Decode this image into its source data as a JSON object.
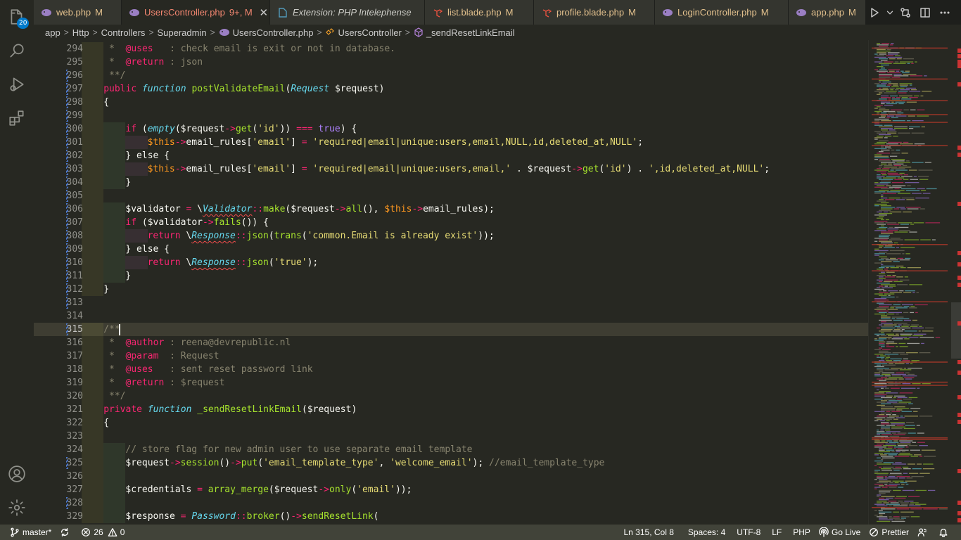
{
  "activity_bar": {
    "explorer_badge": "20",
    "items": [
      "explorer-icon",
      "search-icon",
      "run-debug-icon",
      "extensions-icon"
    ],
    "bottom": [
      "account-icon",
      "settings-gear-icon"
    ]
  },
  "tabs": [
    {
      "label": "web.php",
      "status": "M",
      "style": "mod",
      "icon": "php-elephant-icon",
      "active": false
    },
    {
      "label": "UsersController.php",
      "status": "9+, M",
      "style": "err",
      "icon": "php-elephant-icon",
      "active": true
    },
    {
      "label": "Extension: PHP Intelephense",
      "status": "",
      "style": "ital",
      "icon": "extension-file-icon",
      "active": false
    },
    {
      "label": "list.blade.php",
      "status": "M",
      "style": "mod",
      "icon": "laravel-icon",
      "active": false
    },
    {
      "label": "profile.blade.php",
      "status": "M",
      "style": "mod",
      "icon": "laravel-icon",
      "active": false
    },
    {
      "label": "LoginController.php",
      "status": "M",
      "style": "mod",
      "icon": "php-elephant-icon",
      "active": false
    },
    {
      "label": "app.php",
      "status": "M",
      "style": "mod",
      "icon": "php-elephant-icon",
      "active": false
    }
  ],
  "breadcrumb": {
    "segments": [
      "app",
      "Http",
      "Controllers",
      "Superadmin",
      "UsersController.php",
      "UsersController",
      "_sendResetLinkEmail"
    ]
  },
  "editor": {
    "current_line": 315,
    "lines": [
      {
        "n": "294",
        "mark": false
      },
      {
        "n": "295",
        "mark": false
      },
      {
        "n": "296",
        "mark": true
      },
      {
        "n": "297",
        "mark": true
      },
      {
        "n": "298",
        "mark": true
      },
      {
        "n": "299",
        "mark": true
      },
      {
        "n": "300",
        "mark": true
      },
      {
        "n": "301",
        "mark": true
      },
      {
        "n": "302",
        "mark": true
      },
      {
        "n": "303",
        "mark": true
      },
      {
        "n": "304",
        "mark": true
      },
      {
        "n": "305",
        "mark": true
      },
      {
        "n": "306",
        "mark": true
      },
      {
        "n": "307",
        "mark": true
      },
      {
        "n": "308",
        "mark": true
      },
      {
        "n": "309",
        "mark": true
      },
      {
        "n": "310",
        "mark": true
      },
      {
        "n": "311",
        "mark": true
      },
      {
        "n": "312",
        "mark": true
      },
      {
        "n": "313",
        "mark": true
      },
      {
        "n": "314",
        "mark": false
      },
      {
        "n": "315",
        "mark": true
      },
      {
        "n": "316",
        "mark": false
      },
      {
        "n": "317",
        "mark": false
      },
      {
        "n": "318",
        "mark": false
      },
      {
        "n": "319",
        "mark": false
      },
      {
        "n": "320",
        "mark": false
      },
      {
        "n": "321",
        "mark": false
      },
      {
        "n": "322",
        "mark": false
      },
      {
        "n": "323",
        "mark": false
      },
      {
        "n": "324",
        "mark": false
      },
      {
        "n": "325",
        "mark": true
      },
      {
        "n": "326",
        "mark": false
      },
      {
        "n": "327",
        "mark": false
      },
      {
        "n": "328",
        "mark": true
      },
      {
        "n": "329",
        "mark": false
      }
    ],
    "code": {
      "l294": {
        "star": " *  ",
        "tag": "@uses",
        "text": "   : check email is exit or not in database."
      },
      "l295": {
        "star": " *  ",
        "tag": "@return",
        "text": " : json"
      },
      "l296": " **/",
      "l297": {
        "kw": "public",
        "fn_kw": "function",
        "name": "postValidateEmail",
        "type": "Request",
        "param": "$request"
      },
      "l298": "{",
      "l300": {
        "if": "if",
        "empty": "empty",
        "var": "$request",
        "get": "get",
        "arg": "'id'",
        "op": "===",
        "val": "true"
      },
      "l301": {
        "this": "$this",
        "prop": "email_rules",
        "key": "'email'",
        "value": "'required|email|unique:users,email,NULL,id,deleted_at,NULL'"
      },
      "l302": "} else {",
      "l303": {
        "this": "$this",
        "prop": "email_rules",
        "key": "'email'",
        "value1": "'required|email|unique:users,email,'",
        "var": "$request",
        "get": "get",
        "arg": "'id'",
        "value2": "',id,deleted_at,NULL'"
      },
      "l304": "}",
      "l306": {
        "var": "$validator",
        "cls": "Validator",
        "make": "make",
        "req": "$request",
        "all": "all",
        "this": "$this",
        "prop": "email_rules"
      },
      "l307": {
        "if": "if",
        "var": "$validator",
        "fails": "fails"
      },
      "l308": {
        "ret": "return",
        "cls": "Response",
        "json": "json",
        "trans": "trans",
        "msg": "'common.Email is already exist'"
      },
      "l309": "} else {",
      "l310": {
        "ret": "return",
        "cls": "Response",
        "json": "json",
        "msg": "'true'"
      },
      "l311": "}",
      "l312": "}",
      "l315": "/**",
      "l316": {
        "star": " *  ",
        "tag": "@author",
        "text": " : reena@devrepublic.nl"
      },
      "l317": {
        "star": " *  ",
        "tag": "@param",
        "text": "  : Request"
      },
      "l318": {
        "star": " *  ",
        "tag": "@uses",
        "text": "   : sent reset password link"
      },
      "l319": {
        "star": " *  ",
        "tag": "@return",
        "text": " : $request"
      },
      "l320": " **/",
      "l321": {
        "kw": "private",
        "fn_kw": "function",
        "name": "_sendResetLinkEmail",
        "param": "$request"
      },
      "l322": "{",
      "l324": "// store flag for new admin user to use separate email template",
      "l325": {
        "var": "$request",
        "session": "session",
        "put": "put",
        "a1": "'email_template_type'",
        "a2": "'welcome_email'",
        "cmt": "//email_template_type"
      },
      "l327": {
        "var": "$credentials",
        "fn": "array_merge",
        "req": "$request",
        "only": "only",
        "arg": "'email'"
      },
      "l329": {
        "var": "$response",
        "cls": "Password",
        "broker": "broker",
        "send": "sendResetLink"
      }
    }
  },
  "statusbar": {
    "branch": "master*",
    "errors": "26",
    "warnings": "0",
    "position": "Ln 315, Col 8",
    "spaces": "Spaces: 4",
    "encoding": "UTF-8",
    "eol": "LF",
    "language": "PHP",
    "golive": "Go Live",
    "prettier": "Prettier"
  },
  "colors": {
    "background": "#272822",
    "tabbar": "#1e1f1c",
    "statusbar": "#414339",
    "keyword": "#f92672",
    "function": "#a6e22e",
    "string": "#e6db74",
    "type": "#66d9ef",
    "comment": "#88846f",
    "constant": "#ae81ff"
  }
}
